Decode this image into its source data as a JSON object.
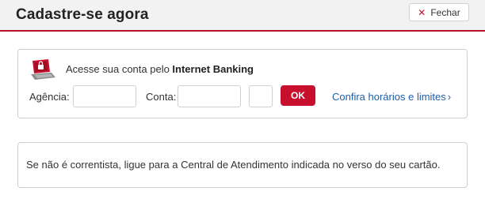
{
  "header": {
    "title": "Cadastre-se agora",
    "close_label": "Fechar",
    "close_icon": "close-icon",
    "accent_color": "#c8102e"
  },
  "login": {
    "icon": "laptop-lock-icon",
    "intro_text": "Acesse sua conta pelo ",
    "intro_bold": "Internet Banking",
    "agencia_label": "Agência:",
    "agencia_value": "",
    "conta_label": "Conta:",
    "conta_value": "",
    "digito_value": "",
    "ok_label": "OK",
    "hours_link": "Confira horários e limites",
    "hours_chevron": "›"
  },
  "info": {
    "text": "Se não é correntista, ligue para a Central de Atendimento indicada no verso do seu cartão."
  }
}
